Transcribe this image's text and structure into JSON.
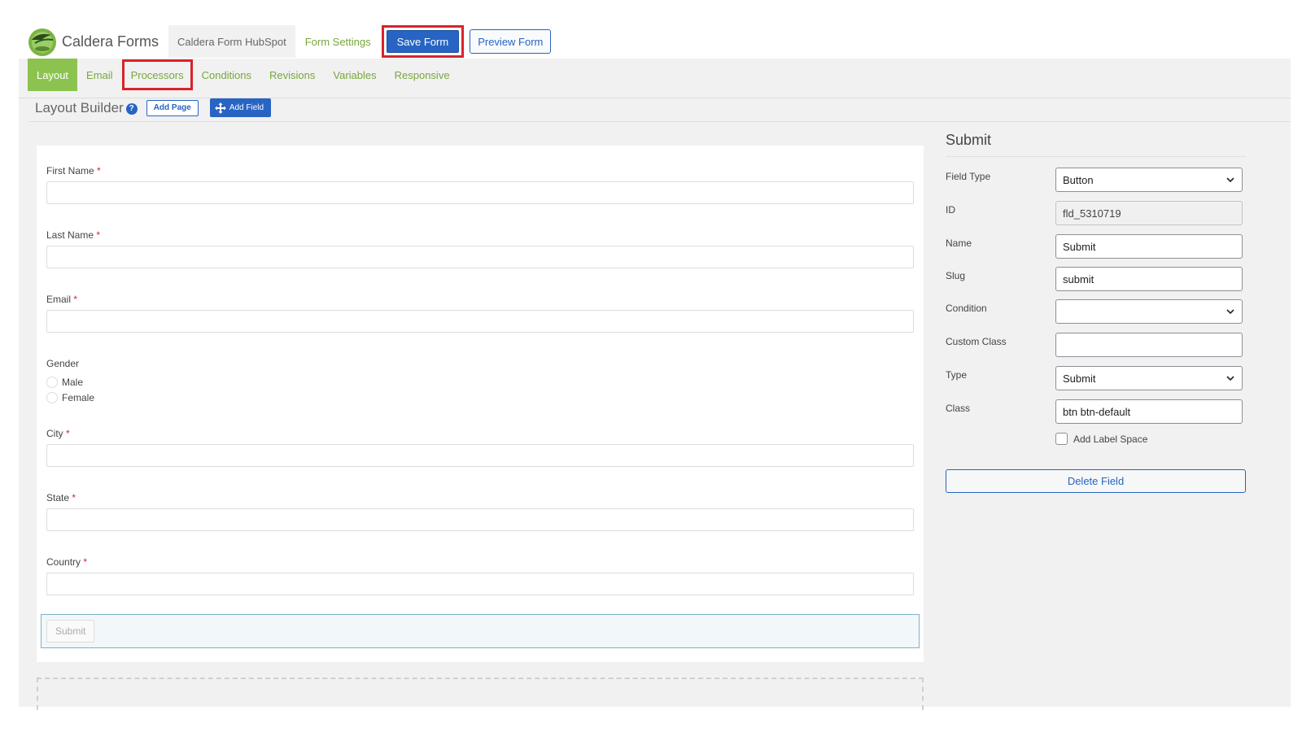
{
  "header": {
    "app_title": "Caldera Forms",
    "form_name": "Caldera Form HubSpot",
    "form_settings_label": "Form Settings",
    "save_label": "Save Form",
    "preview_label": "Preview Form",
    "logo_icon": "caldera-logo-icon"
  },
  "subnav": {
    "items": [
      {
        "label": "Layout",
        "state": "active"
      },
      {
        "label": "Email"
      },
      {
        "label": "Processors",
        "state": "highlighted"
      },
      {
        "label": "Conditions"
      },
      {
        "label": "Revisions"
      },
      {
        "label": "Variables"
      },
      {
        "label": "Responsive"
      }
    ]
  },
  "builder": {
    "title": "Layout Builder",
    "help_glyph": "?",
    "add_page_label": "Add Page",
    "add_field_label": "Add Field"
  },
  "form": {
    "required_mark": "*",
    "fields": [
      {
        "label": "First Name",
        "required": true
      },
      {
        "label": "Last Name",
        "required": true
      },
      {
        "label": "Email",
        "required": true
      },
      {
        "label": "Gender",
        "options": [
          "Male",
          "Female"
        ]
      },
      {
        "label": "City",
        "required": true
      },
      {
        "label": "State",
        "required": true
      },
      {
        "label": "Country",
        "required": true
      }
    ],
    "submit_label": "Submit"
  },
  "settings": {
    "title": "Submit",
    "field_type_label": "Field Type",
    "field_type_value": "Button",
    "id_label": "ID",
    "id_value": "fld_5310719",
    "name_label": "Name",
    "name_value": "Submit",
    "slug_label": "Slug",
    "slug_value": "submit",
    "condition_label": "Condition",
    "condition_value": "",
    "custom_class_label": "Custom Class",
    "custom_class_value": "",
    "type_label": "Type",
    "type_value": "Submit",
    "class_label": "Class",
    "class_value": "btn btn-default",
    "add_label_space_label": "Add Label Space",
    "add_label_space_checked": false,
    "delete_label": "Delete Field"
  },
  "colors": {
    "accent_green": "#8cc350",
    "link_green": "#79a63b",
    "primary_blue": "#2764c3",
    "highlight_red": "#d8232a"
  }
}
